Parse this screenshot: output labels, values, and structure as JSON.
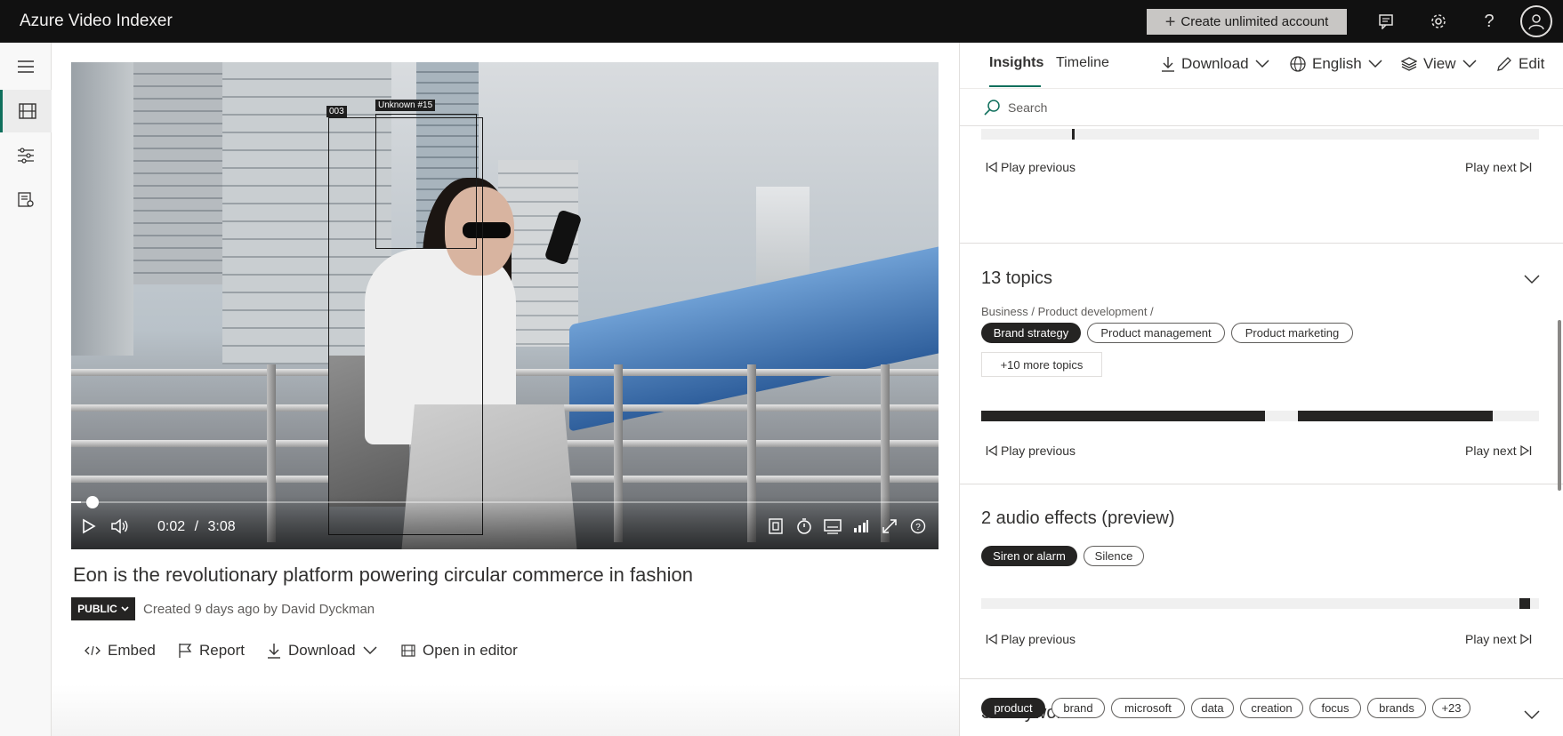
{
  "app": {
    "title": "Azure Video Indexer",
    "create_account_label": "Create unlimited account",
    "top_icons": [
      "feedback-icon",
      "settings-icon",
      "help-icon",
      "account-icon"
    ]
  },
  "rail": {
    "items": [
      "hamburger-menu-icon",
      "film-icon",
      "filters-icon",
      "document-settings-icon"
    ],
    "active_index": 1
  },
  "player": {
    "current_time": "0:02",
    "separator": "/",
    "duration": "3:08",
    "progress_fraction": 0.011,
    "overlays": [
      {
        "label": "003"
      },
      {
        "label": "Unknown #15"
      }
    ],
    "controls": [
      "play-icon",
      "volume-icon",
      "camera-icon",
      "timer-icon",
      "captions-icon",
      "quality-icon",
      "fullscreen-icon",
      "help-icon"
    ]
  },
  "video": {
    "title": "Eon is the revolutionary platform powering circular commerce in fashion",
    "visibility": "PUBLIC",
    "created_text": "Created 9 days ago by David Dyckman",
    "actions": {
      "embed": "Embed",
      "report": "Report",
      "download": "Download",
      "open_editor": "Open in editor"
    }
  },
  "panel": {
    "tabs": {
      "insights": "Insights",
      "timeline": "Timeline"
    },
    "tools": {
      "download": "Download",
      "language": "English",
      "view": "View",
      "edit": "Edit"
    },
    "search_placeholder": "Search",
    "play_previous": "Play previous",
    "play_next": "Play next",
    "topics": {
      "title": "13 topics",
      "breadcrumb": "Business / Product development /",
      "pills": [
        "Brand strategy",
        "Product management",
        "Product marketing"
      ],
      "more": "+10 more topics"
    },
    "audio_effects": {
      "title": "2 audio effects (preview)",
      "pills": [
        "Siren or alarm",
        "Silence"
      ]
    },
    "keywords": {
      "title": "30 keywords",
      "pills": [
        "product",
        "brand",
        "microsoft",
        "data",
        "creation",
        "focus",
        "brands",
        "+23"
      ]
    }
  }
}
